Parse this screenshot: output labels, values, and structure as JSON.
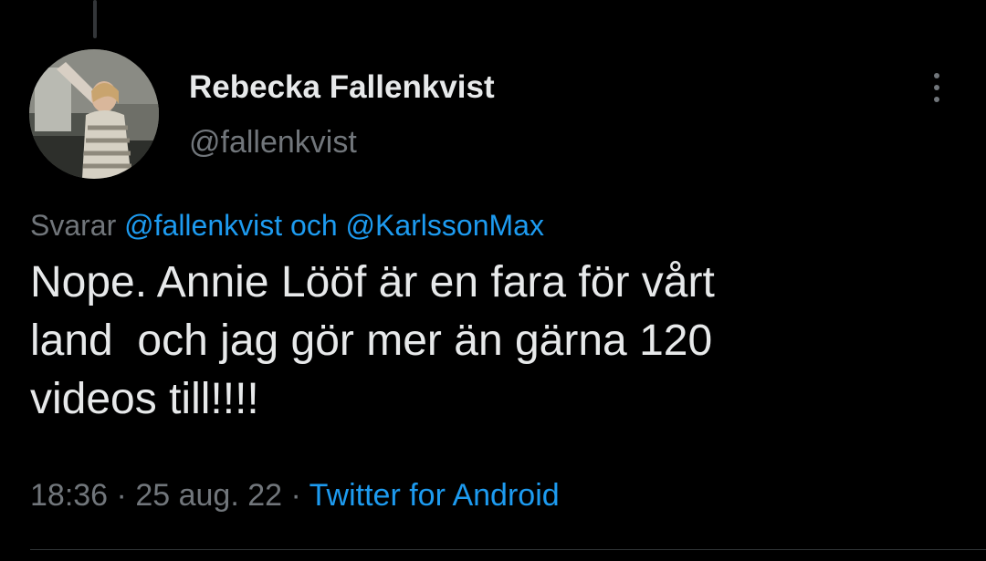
{
  "colors": {
    "background": "#000000",
    "primary_text": "#e7e9ea",
    "secondary_text": "#71767b",
    "link": "#1d9bf0"
  },
  "author": {
    "display_name": "Rebecka Fallenkvist",
    "handle": "@fallenkvist",
    "avatar_icon": "profile-photo"
  },
  "reply_context": {
    "prefix": "Svarar",
    "mention_1": "@fallenkvist",
    "joiner": "och",
    "mention_2": "@KarlssonMax"
  },
  "tweet": {
    "lines": [
      "Nope. Annie Lööf är en fara för vårt",
      "land  och jag gör mer än gärna 120",
      "videos till!!!!"
    ]
  },
  "meta": {
    "time": "18:36",
    "separator": "·",
    "date": "25 aug. 22",
    "source": "Twitter for Android"
  },
  "more_icon": "more-vertical-icon"
}
